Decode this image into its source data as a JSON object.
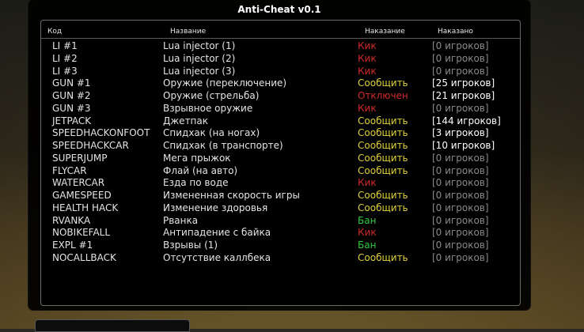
{
  "window": {
    "title": "Anti-Cheat v0.1"
  },
  "columns": {
    "code": "Код",
    "name": "Название",
    "punishment": "Наказание",
    "punished": "Наказано"
  },
  "colors": {
    "kick": "#d02a2a",
    "report": "#e0d23a",
    "disabled": "#d02a2a",
    "ban": "#2ecc40"
  },
  "rows": [
    {
      "code": "LI #1",
      "name": "Lua injector (1)",
      "punishment": "Кик",
      "ptype": "kick",
      "punished": "[0 игроков]"
    },
    {
      "code": "LI #2",
      "name": "Lua injector (2)",
      "punishment": "Кик",
      "ptype": "kick",
      "punished": "[0 игроков]"
    },
    {
      "code": "LI #3",
      "name": "Lua injector (3)",
      "punishment": "Кик",
      "ptype": "kick",
      "punished": "[0 игроков]"
    },
    {
      "code": "GUN #1",
      "name": "Оружие (переключение)",
      "punishment": "Сообщить",
      "ptype": "report",
      "punished": "[25 игроков]"
    },
    {
      "code": "GUN #2",
      "name": "Оружие (стрельба)",
      "punishment": "Отключен",
      "ptype": "off",
      "punished": "[21 игроков]"
    },
    {
      "code": "GUN #3",
      "name": "Взрывное оружие",
      "punishment": "Кик",
      "ptype": "kick",
      "punished": "[0 игроков]"
    },
    {
      "code": "JETPACK",
      "name": "Джетпак",
      "punishment": "Сообщить",
      "ptype": "report",
      "punished": "[144 игроков]"
    },
    {
      "code": "SPEEDHACKONFOOT",
      "name": "Спидхак (на ногах)",
      "punishment": "Сообщить",
      "ptype": "report",
      "punished": "[3 игроков]"
    },
    {
      "code": "SPEEDHACKCAR",
      "name": "Спидхак (в транспорте)",
      "punishment": "Сообщить",
      "ptype": "report",
      "punished": "[10 игроков]"
    },
    {
      "code": "SUPERJUMP",
      "name": "Мега прыжок",
      "punishment": "Сообщить",
      "ptype": "report",
      "punished": "[0 игроков]"
    },
    {
      "code": "FLYCAR",
      "name": "Флай (на авто)",
      "punishment": "Сообщить",
      "ptype": "report",
      "punished": "[0 игроков]"
    },
    {
      "code": "WATERCAR",
      "name": "Езда по воде",
      "punishment": "Кик",
      "ptype": "kick",
      "punished": "[0 игроков]"
    },
    {
      "code": "GAMESPEED",
      "name": "Измененная скорость игры",
      "punishment": "Сообщить",
      "ptype": "report",
      "punished": "[0 игроков]"
    },
    {
      "code": "HEALTH HACK",
      "name": "Изменение здоровья",
      "punishment": "Сообщить",
      "ptype": "report",
      "punished": "[0 игроков]"
    },
    {
      "code": "RVANKA",
      "name": "Рванка",
      "punishment": "Бан",
      "ptype": "ban",
      "punished": "[0 игроков]"
    },
    {
      "code": "NOBIKEFALL",
      "name": "Антипадение с байка",
      "punishment": "Кик",
      "ptype": "kick",
      "punished": "[0 игроков]"
    },
    {
      "code": "EXPL #1",
      "name": "Взрывы (1)",
      "punishment": "Бан",
      "ptype": "ban",
      "punished": "[0 игроков]"
    },
    {
      "code": "NOCALLBACK",
      "name": "Отсутствие каллбека",
      "punishment": "Сообщить",
      "ptype": "report",
      "punished": "[0 игроков]"
    }
  ]
}
